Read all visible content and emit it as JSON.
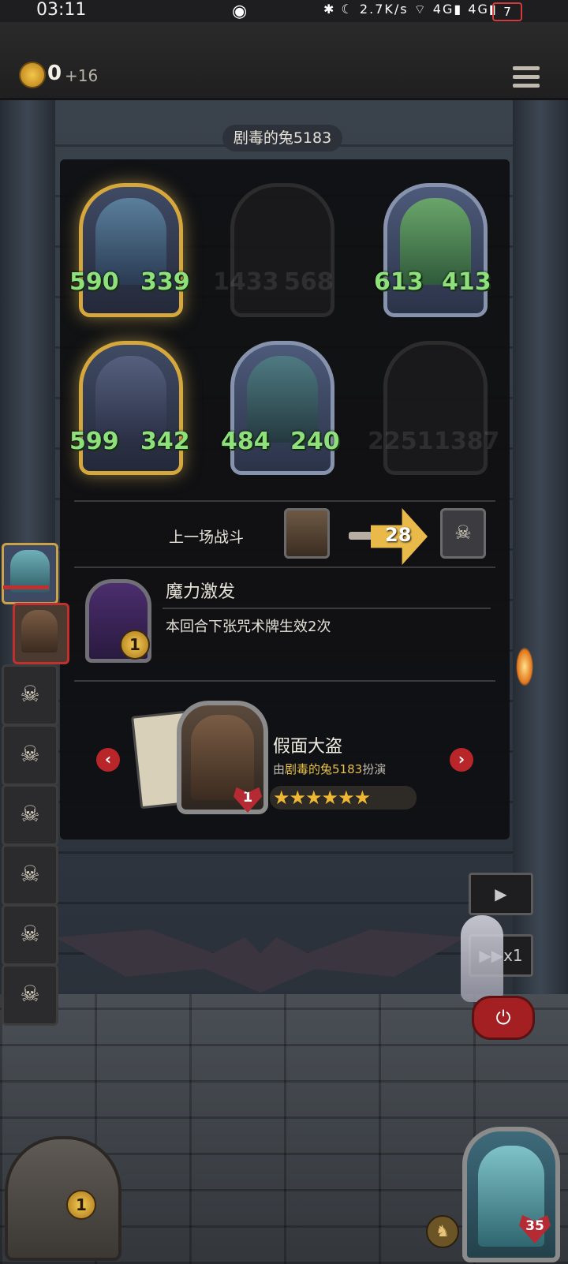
{
  "status_bar": {
    "time": "03:11",
    "right_icons": "✱ ☾ 2.7K/s ⌔ 4G▮ 4G▮",
    "battery": "7"
  },
  "top_bar": {
    "coins": "0",
    "coin_increment": "+16",
    "menu_icon": "menu-icon"
  },
  "opponent": {
    "name": "剧毒的兔5183"
  },
  "board": {
    "units": [
      {
        "attack": "590",
        "health": "339",
        "frame": "gold",
        "visible": true
      },
      {
        "attack": "1433",
        "health": "568",
        "frame": "ghost",
        "visible": false
      },
      {
        "attack": "613",
        "health": "413",
        "frame": "silver",
        "visible": true
      },
      {
        "attack": "599",
        "health": "342",
        "frame": "gold",
        "visible": true
      },
      {
        "attack": "484",
        "health": "240",
        "frame": "silver",
        "visible": true
      },
      {
        "attack": "2251",
        "health": "1387",
        "frame": "ghost",
        "visible": false
      }
    ]
  },
  "last_battle": {
    "label": "上一场战斗",
    "damage": "28"
  },
  "spell": {
    "title": "魔力激发",
    "description": "本回合下张咒术牌生效2次",
    "cost": "1"
  },
  "hero": {
    "name": "假面大盗",
    "played_by_prefix": "由",
    "played_by_name": "剧毒的兔5183",
    "played_by_suffix": "扮演",
    "health": "1",
    "stars": "★★★★★★"
  },
  "nav": {
    "prev": "‹",
    "next": "›"
  },
  "controls": {
    "play": "▶",
    "speed": "▶▶x1",
    "power": "⏻"
  },
  "bottom": {
    "chest_count": "1",
    "player_health": "35"
  },
  "colors": {
    "stat_green": "#8ee07a",
    "gold_frame": "#d6a73c",
    "accent_red": "#b8262a"
  }
}
